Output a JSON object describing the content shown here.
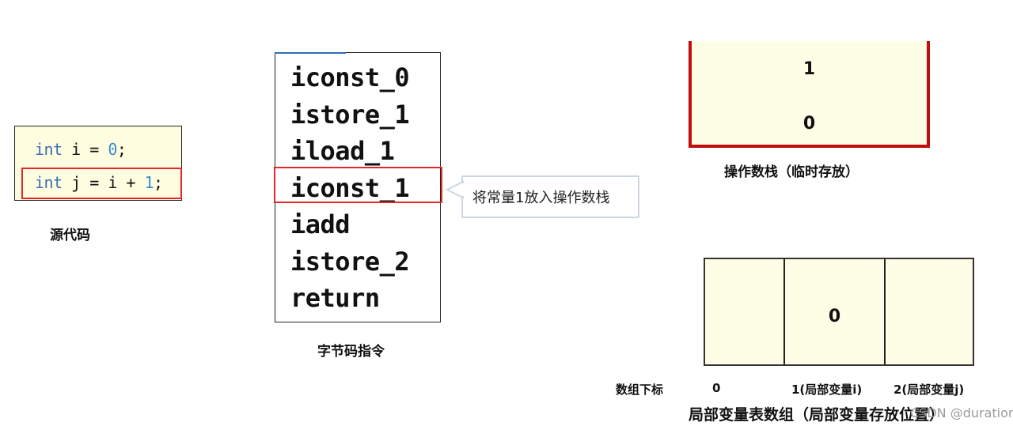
{
  "source_code": {
    "lines": [
      {
        "keyword": "int",
        "rest": " i = ",
        "number": "0",
        "end": ";"
      },
      {
        "keyword": "int",
        "rest": " j = i + ",
        "number": "1",
        "end": ";"
      }
    ],
    "highlighted_line": 2,
    "caption": "源代码"
  },
  "bytecode": {
    "instructions": [
      "iconst_0",
      "istore_1",
      "iload_1",
      "iconst_1",
      "iadd",
      "istore_2",
      "return"
    ],
    "highlighted_instruction": "iconst_1",
    "caption": "字节码指令"
  },
  "callout": {
    "text": "将常量1放入操作数栈"
  },
  "operand_stack": {
    "values_top_to_bottom": [
      "1",
      "0"
    ],
    "caption": "操作数栈（临时存放）",
    "border_color": "#c00d0d"
  },
  "local_variable_table": {
    "cells": [
      "",
      "0",
      ""
    ],
    "index_label": "数组下标",
    "indices": [
      "0",
      "1(局部变量i)",
      "2(局部变量j)"
    ],
    "caption": "局部变量表数组（局部变量存放位置）"
  },
  "watermark": "CSDN @duration ~",
  "colors": {
    "highlight_red": "#e5262a",
    "panel_fill": "#fefde0",
    "keyword_blue": "#3a6fb0"
  }
}
